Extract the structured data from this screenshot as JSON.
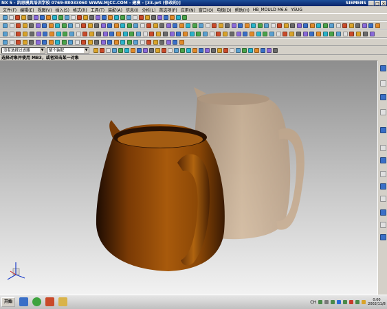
{
  "window": {
    "title": "NX 5 - 凯思模具培训学校  0769-88033060  WWW.MJCC.COM - 建模 - [33.prt (修改的)]",
    "brand": "SIEMENS",
    "controls": [
      "_",
      "□",
      "×"
    ]
  },
  "menubar": {
    "items": [
      "文件(F)",
      "编辑(E)",
      "视图(V)",
      "插入(S)",
      "格式(R)",
      "工具(T)",
      "装配(A)",
      "信息(I)",
      "分析(L)",
      "首选项(P)",
      "应用(N)",
      "窗口(O)",
      "电极(D)",
      "帮助(H)",
      "HB_MOULD M6.6",
      "YSUG"
    ]
  },
  "selection_bar": {
    "filter_value": "没有选择过滤器",
    "scope_value": "整个装配"
  },
  "cue_line": {
    "text": "选择对象并使用 MB3，或者双击某一对象"
  },
  "taskbar": {
    "start_label": "开始",
    "language": "CH",
    "clock_time": "0:00",
    "clock_date": "2002/11/8"
  },
  "colors": {
    "title_bar": "#0a246a",
    "chrome": "#d4d0c8",
    "pitcher_solid": "#8a4706",
    "pitcher_ghost": "#c9a37c"
  }
}
